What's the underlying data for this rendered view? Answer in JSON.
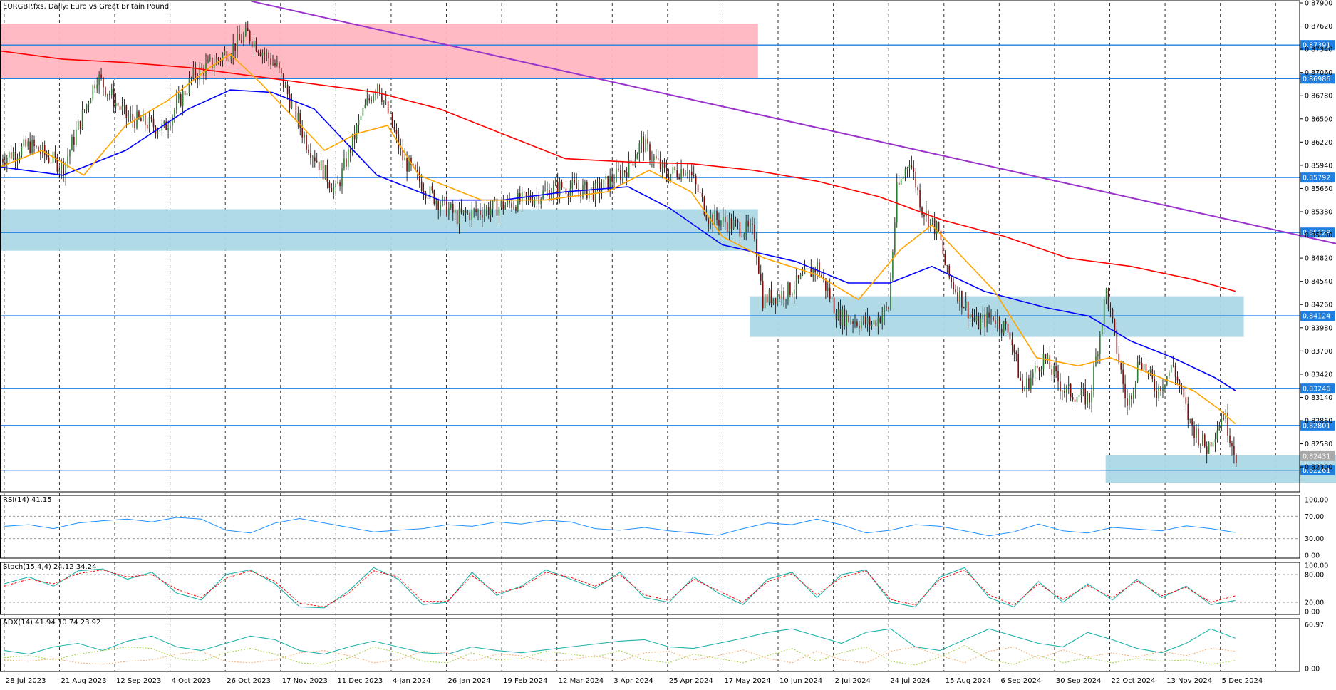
{
  "window": {
    "title": "EURGBP.fxs, Daily:  Euro vs Great Britain Pound"
  },
  "chart_data": {
    "type": "line",
    "symbol": "EURGBP.fxs",
    "timeframe": "Daily",
    "description": "Euro vs Great Britain Pound",
    "x_labels": [
      "28 Jul 2023",
      "21 Aug 2023",
      "12 Sep 2023",
      "4 Oct 2023",
      "26 Oct 2023",
      "17 Nov 2023",
      "11 Dec 2023",
      "4 Jan 2024",
      "26 Jan 2024",
      "19 Feb 2024",
      "12 Mar 2024",
      "3 Apr 2024",
      "25 Apr 2024",
      "17 May 2024",
      "10 Jun 2024",
      "2 Jul 2024",
      "24 Jul 2024",
      "15 Aug 2024",
      "6 Sep 2024",
      "30 Sep 2024",
      "22 Oct 2024",
      "13 Nov 2024",
      "5 Dec 2024"
    ],
    "price_axis": {
      "ylim": [
        0.82,
        0.879
      ],
      "ticks": [
        "0.87900",
        "0.87620",
        "0.87340",
        "0.87060",
        "0.86780",
        "0.86500",
        "0.86220",
        "0.85940",
        "0.85660",
        "0.85380",
        "0.85100",
        "0.84820",
        "0.84540",
        "0.84260",
        "0.83980",
        "0.83700",
        "0.83420",
        "0.83140",
        "0.82860",
        "0.82580",
        "0.82300"
      ],
      "tick_values": [
        0.879,
        0.8762,
        0.8734,
        0.8706,
        0.8678,
        0.865,
        0.8622,
        0.8594,
        0.8566,
        0.8538,
        0.851,
        0.8482,
        0.8454,
        0.8426,
        0.8398,
        0.837,
        0.8342,
        0.8314,
        0.8286,
        0.8258,
        0.823
      ]
    },
    "horizontal_levels": [
      {
        "label": "0.87391",
        "value": 0.87391
      },
      {
        "label": "0.86986",
        "value": 0.86986
      },
      {
        "label": "0.85792",
        "value": 0.85792
      },
      {
        "label": "0.85129",
        "value": 0.85129
      },
      {
        "label": "0.84124",
        "value": 0.84124
      },
      {
        "label": "0.83246",
        "value": 0.83246
      },
      {
        "label": "0.82801",
        "value": 0.82801
      },
      {
        "label": "0.82261",
        "value": 0.82261
      }
    ],
    "current_price": {
      "label": "0.82431",
      "value": 0.82431
    },
    "zones": [
      {
        "color": "#ffb6c1",
        "x_start": 0,
        "x_end": 362,
        "y_top": 0.8765,
        "y_bottom": 0.8699
      },
      {
        "color": "#add8e6",
        "x_start": 0,
        "x_end": 362,
        "y_top": 0.8541,
        "y_bottom": 0.8491
      },
      {
        "color": "#add8e6",
        "x_start": 358,
        "x_end": 594,
        "y_top": 0.8436,
        "y_bottom": 0.8387
      },
      {
        "color": "#add8e6",
        "x_start": 528,
        "x_end": 694,
        "y_top": 0.8244,
        "y_bottom": 0.8211
      }
    ],
    "trendline": {
      "color": "#9933cc",
      "x_start": 120,
      "y_start": 0.8792,
      "x_end": 678,
      "y_end": 0.8477
    },
    "bars_count": 620,
    "close_path": [
      [
        0,
        0.8602
      ],
      [
        14,
        0.8618
      ],
      [
        30,
        0.8592
      ],
      [
        46,
        0.8702
      ],
      [
        60,
        0.8652
      ],
      [
        78,
        0.8638
      ],
      [
        92,
        0.8702
      ],
      [
        104,
        0.8722
      ],
      [
        118,
        0.8752
      ],
      [
        132,
        0.8712
      ],
      [
        146,
        0.8622
      ],
      [
        160,
        0.8562
      ],
      [
        172,
        0.8652
      ],
      [
        180,
        0.8695
      ],
      [
        192,
        0.8602
      ],
      [
        204,
        0.8562
      ],
      [
        218,
        0.8532
      ],
      [
        234,
        0.8542
      ],
      [
        250,
        0.8552
      ],
      [
        268,
        0.8568
      ],
      [
        284,
        0.8562
      ],
      [
        300,
        0.8592
      ],
      [
        306,
        0.8622
      ],
      [
        318,
        0.8582
      ],
      [
        328,
        0.8592
      ],
      [
        338,
        0.8532
      ],
      [
        350,
        0.8522
      ],
      [
        360,
        0.8512
      ],
      [
        364,
        0.8432
      ],
      [
        376,
        0.8442
      ],
      [
        390,
        0.8472
      ],
      [
        400,
        0.8412
      ],
      [
        416,
        0.8402
      ],
      [
        424,
        0.8422
      ],
      [
        428,
        0.8562
      ],
      [
        434,
        0.8602
      ],
      [
        440,
        0.8542
      ],
      [
        448,
        0.8512
      ],
      [
        452,
        0.8462
      ],
      [
        466,
        0.8402
      ],
      [
        474,
        0.8412
      ],
      [
        482,
        0.8392
      ],
      [
        488,
        0.8322
      ],
      [
        498,
        0.8362
      ],
      [
        508,
        0.8322
      ],
      [
        520,
        0.8312
      ],
      [
        528,
        0.8442
      ],
      [
        538,
        0.8302
      ],
      [
        544,
        0.8362
      ],
      [
        552,
        0.8322
      ],
      [
        560,
        0.8352
      ],
      [
        568,
        0.8282
      ],
      [
        576,
        0.8252
      ],
      [
        584,
        0.8295
      ],
      [
        590,
        0.8243
      ]
    ],
    "series": [
      {
        "name": "",
        "color": "#ff0000",
        "path": [
          [
            0,
            0.8732
          ],
          [
            30,
            0.8722
          ],
          [
            60,
            0.8718
          ],
          [
            90,
            0.8712
          ],
          [
            120,
            0.8702
          ],
          [
            150,
            0.8692
          ],
          [
            180,
            0.8682
          ],
          [
            210,
            0.8662
          ],
          [
            240,
            0.8632
          ],
          [
            270,
            0.8602
          ],
          [
            300,
            0.8598
          ],
          [
            330,
            0.8596
          ],
          [
            360,
            0.8588
          ],
          [
            390,
            0.8575
          ],
          [
            420,
            0.8556
          ],
          [
            450,
            0.8528
          ],
          [
            480,
            0.8508
          ],
          [
            510,
            0.8482
          ],
          [
            540,
            0.8472
          ],
          [
            570,
            0.8456
          ],
          [
            590,
            0.8442
          ]
        ]
      },
      {
        "name": "",
        "color": "#0000ff",
        "path": [
          [
            0,
            0.8592
          ],
          [
            30,
            0.8582
          ],
          [
            60,
            0.8612
          ],
          [
            90,
            0.8662
          ],
          [
            110,
            0.8685
          ],
          [
            130,
            0.8682
          ],
          [
            150,
            0.8662
          ],
          [
            180,
            0.8582
          ],
          [
            210,
            0.8552
          ],
          [
            240,
            0.8552
          ],
          [
            270,
            0.8562
          ],
          [
            300,
            0.8568
          ],
          [
            320,
            0.8542
          ],
          [
            345,
            0.8498
          ],
          [
            380,
            0.8478
          ],
          [
            405,
            0.8452
          ],
          [
            425,
            0.8452
          ],
          [
            445,
            0.8472
          ],
          [
            470,
            0.8442
          ],
          [
            500,
            0.8422
          ],
          [
            520,
            0.8412
          ],
          [
            540,
            0.8382
          ],
          [
            560,
            0.8362
          ],
          [
            580,
            0.8338
          ],
          [
            590,
            0.8322
          ]
        ]
      },
      {
        "name": "",
        "color": "#ffa500",
        "path": [
          [
            0,
            0.8592
          ],
          [
            20,
            0.8612
          ],
          [
            40,
            0.8582
          ],
          [
            60,
            0.8642
          ],
          [
            80,
            0.8672
          ],
          [
            100,
            0.8712
          ],
          [
            110,
            0.8728
          ],
          [
            125,
            0.8692
          ],
          [
            140,
            0.8652
          ],
          [
            155,
            0.8612
          ],
          [
            170,
            0.8632
          ],
          [
            185,
            0.8642
          ],
          [
            200,
            0.8582
          ],
          [
            230,
            0.8552
          ],
          [
            260,
            0.8552
          ],
          [
            290,
            0.8562
          ],
          [
            310,
            0.8588
          ],
          [
            330,
            0.8562
          ],
          [
            345,
            0.8508
          ],
          [
            365,
            0.8482
          ],
          [
            390,
            0.8462
          ],
          [
            410,
            0.8432
          ],
          [
            430,
            0.8492
          ],
          [
            445,
            0.8522
          ],
          [
            460,
            0.8482
          ],
          [
            475,
            0.8442
          ],
          [
            495,
            0.8362
          ],
          [
            515,
            0.8352
          ],
          [
            530,
            0.8362
          ],
          [
            550,
            0.8342
          ],
          [
            570,
            0.8322
          ],
          [
            582,
            0.83
          ],
          [
            590,
            0.8282
          ]
        ]
      }
    ],
    "indicators": [
      {
        "name": "RSI",
        "label": "RSI(14) 41.15",
        "levels": [
          {
            "label": "100.00",
            "value": 100
          },
          {
            "label": "70.00",
            "value": 70
          },
          {
            "label": "30.00",
            "value": 30
          },
          {
            "label": "0.00",
            "value": 0
          }
        ],
        "ylim": [
          0,
          100
        ],
        "values": [
          52,
          55,
          48,
          58,
          62,
          65,
          60,
          68,
          65,
          45,
          40,
          58,
          66,
          58,
          50,
          42,
          45,
          48,
          55,
          52,
          60,
          56,
          63,
          60,
          48,
          45,
          50,
          44,
          40,
          36,
          48,
          58,
          55,
          65,
          55,
          40,
          45,
          55,
          52,
          44,
          35,
          42,
          56,
          44,
          40,
          50,
          47,
          44,
          53,
          48,
          41
        ]
      },
      {
        "name": "Stochastic",
        "label": "Stoch(15,4,4) 24.12 34.24",
        "levels": [
          {
            "label": "100.00",
            "value": 100
          },
          {
            "label": "80.00",
            "value": 80
          },
          {
            "label": "20.00",
            "value": 20
          },
          {
            "label": "0.00",
            "value": 0
          }
        ],
        "ylim": [
          0,
          100
        ],
        "main": [
          60,
          75,
          55,
          88,
          92,
          70,
          85,
          40,
          25,
          80,
          90,
          60,
          10,
          8,
          45,
          95,
          70,
          15,
          20,
          85,
          35,
          55,
          90,
          70,
          50,
          85,
          30,
          20,
          75,
          40,
          15,
          70,
          85,
          30,
          80,
          90,
          20,
          10,
          75,
          95,
          30,
          10,
          65,
          20,
          60,
          25,
          70,
          30,
          55,
          15,
          24
        ],
        "signal": [
          55,
          70,
          60,
          82,
          90,
          75,
          80,
          48,
          30,
          72,
          88,
          65,
          18,
          10,
          40,
          88,
          75,
          22,
          22,
          78,
          40,
          52,
          85,
          74,
          55,
          80,
          36,
          24,
          70,
          45,
          20,
          65,
          82,
          36,
          74,
          88,
          26,
          14,
          70,
          90,
          36,
          14,
          60,
          26,
          56,
          30,
          66,
          34,
          52,
          20,
          34
        ]
      },
      {
        "name": "ADX",
        "label": "ADX(14) 41.94 10.74 23.92",
        "levels": [
          {
            "label": "60.97",
            "value": 60.97
          },
          {
            "label": "0.00",
            "value": 0
          }
        ],
        "ylim": [
          0,
          65
        ],
        "adx": [
          25,
          20,
          30,
          35,
          25,
          38,
          45,
          30,
          25,
          35,
          45,
          40,
          25,
          20,
          30,
          38,
          30,
          22,
          20,
          30,
          25,
          22,
          26,
          30,
          34,
          38,
          40,
          30,
          28,
          35,
          42,
          50,
          55,
          45,
          35,
          50,
          55,
          30,
          25,
          40,
          55,
          45,
          35,
          30,
          50,
          40,
          28,
          22,
          35,
          55,
          42
        ],
        "plus_di": [
          15,
          18,
          12,
          20,
          25,
          30,
          28,
          14,
          10,
          22,
          28,
          20,
          8,
          6,
          15,
          30,
          22,
          10,
          8,
          22,
          12,
          14,
          24,
          20,
          16,
          25,
          12,
          8,
          20,
          14,
          8,
          18,
          28,
          10,
          22,
          30,
          10,
          5,
          16,
          32,
          12,
          6,
          18,
          8,
          15,
          8,
          14,
          10,
          12,
          6,
          11
        ],
        "minus_di": [
          12,
          10,
          14,
          8,
          6,
          10,
          12,
          20,
          24,
          10,
          8,
          12,
          22,
          25,
          18,
          8,
          12,
          24,
          22,
          10,
          20,
          18,
          10,
          12,
          18,
          10,
          22,
          24,
          12,
          18,
          26,
          14,
          8,
          24,
          12,
          8,
          24,
          30,
          18,
          8,
          24,
          30,
          14,
          26,
          16,
          22,
          16,
          24,
          18,
          28,
          24
        ]
      }
    ]
  }
}
